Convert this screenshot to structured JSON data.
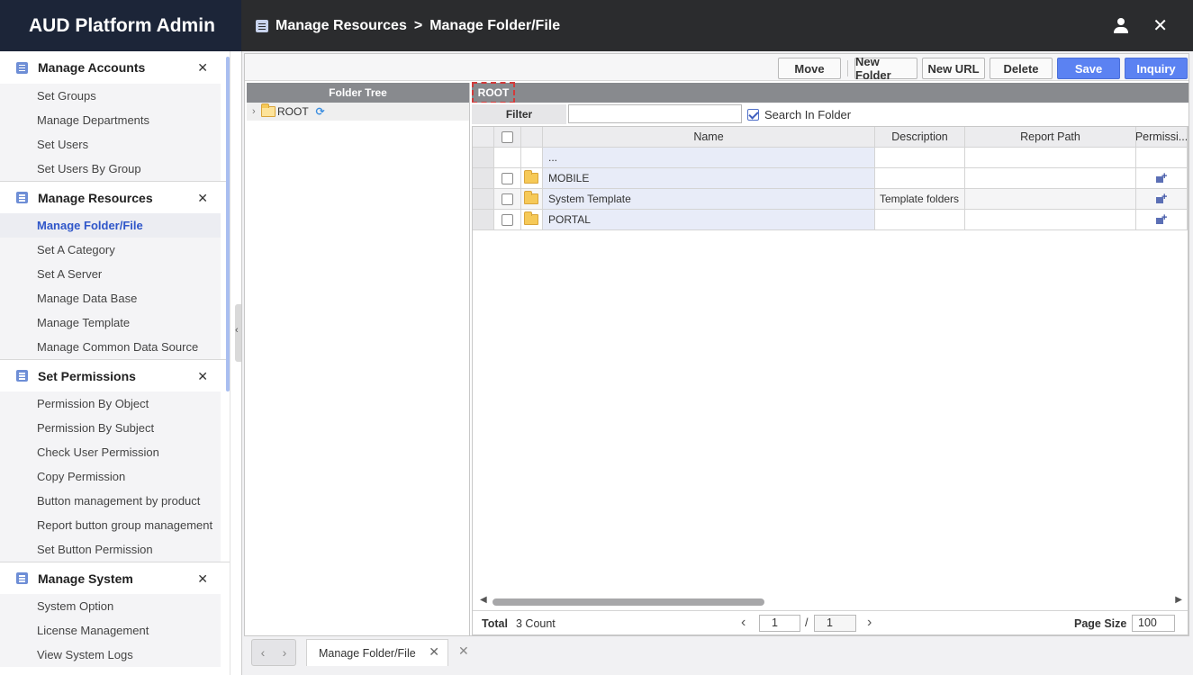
{
  "app": {
    "title": "AUD Platform Admin"
  },
  "header": {
    "breadcrumb_section": "Manage Resources",
    "breadcrumb_sep": ">",
    "breadcrumb_page": "Manage Folder/File"
  },
  "sidebar": {
    "sections": [
      {
        "title": "Manage Accounts",
        "items": [
          "Set Groups",
          "Manage Departments",
          "Set Users",
          "Set Users By Group"
        ]
      },
      {
        "title": "Manage Resources",
        "items": [
          "Manage Folder/File",
          "Set A Category",
          "Set A Server",
          "Manage Data Base",
          "Manage Template",
          "Manage Common Data Source"
        ]
      },
      {
        "title": "Set Permissions",
        "items": [
          "Permission By Object",
          "Permission By Subject",
          "Check User Permission",
          "Copy Permission",
          "Button management by product",
          "Report button group management",
          "Set Button Permission"
        ]
      },
      {
        "title": "Manage System",
        "items": [
          "System Option",
          "License Management",
          "View System Logs"
        ]
      }
    ],
    "active_item": "Manage Folder/File"
  },
  "toolbar": {
    "move": "Move",
    "new_folder": "New Folder",
    "new_url": "New URL",
    "delete": "Delete",
    "save": "Save",
    "inquiry": "Inquiry"
  },
  "tree": {
    "header": "Folder Tree",
    "root_label": "ROOT"
  },
  "panel": {
    "path": "ROOT",
    "filter_label": "Filter",
    "filter_value": "",
    "search_in_folder_label": "Search In Folder",
    "search_in_folder_checked": true
  },
  "grid": {
    "columns": [
      "Name",
      "Description",
      "Report Path",
      "Permissi..."
    ],
    "rows": [
      {
        "name": "...",
        "description": "",
        "report_path": "",
        "is_folder": false
      },
      {
        "name": "MOBILE",
        "description": "",
        "report_path": "",
        "is_folder": true
      },
      {
        "name": "System Template",
        "description": "Template folders",
        "report_path": "",
        "is_folder": true
      },
      {
        "name": "PORTAL",
        "description": "",
        "report_path": "",
        "is_folder": true
      }
    ],
    "footer": {
      "total_label": "Total",
      "count_text": "3 Count",
      "current_page": "1",
      "page_sep": "/",
      "total_pages": "1",
      "page_size_label": "Page Size",
      "page_size": "100"
    }
  },
  "tabs": {
    "open": [
      "Manage Folder/File"
    ]
  },
  "icons": {
    "header": [
      "document-icon",
      "user-icon",
      "close-icon"
    ],
    "grid": [
      "folder-icon",
      "permission-add-icon"
    ],
    "tree": [
      "chevron-right-icon",
      "folder-open-icon",
      "refresh-icon"
    ]
  },
  "colors": {
    "brand_bg": "#1c2538",
    "topbar_bg": "#2b2c2e",
    "accent_blue": "#5b82f2",
    "active_link": "#2f56c9"
  }
}
